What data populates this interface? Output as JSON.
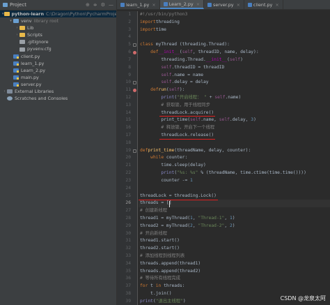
{
  "project_panel": {
    "title": "Project",
    "tree": [
      {
        "indent": 0,
        "arrow": "▾",
        "icon": "folder",
        "label": "python-learn",
        "sub": "C:\\Dragon\\Python\\PycharmProjects\\pytho",
        "bold": true
      },
      {
        "indent": 1,
        "arrow": "▾",
        "icon": "folder",
        "label": "venv",
        "sub": "library root"
      },
      {
        "indent": 2,
        "arrow": "›",
        "icon": "folder",
        "label": "Lib"
      },
      {
        "indent": 2,
        "arrow": "›",
        "icon": "folder",
        "label": "Scripts"
      },
      {
        "indent": 2,
        "arrow": "",
        "icon": "file",
        "label": ".gitignore"
      },
      {
        "indent": 2,
        "arrow": "",
        "icon": "file",
        "label": "pyvenv.cfg"
      },
      {
        "indent": 1,
        "arrow": "",
        "icon": "py",
        "label": "client.py"
      },
      {
        "indent": 1,
        "arrow": "",
        "icon": "py",
        "label": "learn_1.py"
      },
      {
        "indent": 1,
        "arrow": "",
        "icon": "py",
        "label": "Learn_2.py"
      },
      {
        "indent": 1,
        "arrow": "",
        "icon": "py",
        "label": "main.py"
      },
      {
        "indent": 1,
        "arrow": "",
        "icon": "py",
        "label": "server.py"
      },
      {
        "indent": 0,
        "arrow": "›",
        "icon": "lib",
        "label": "External Libraries"
      },
      {
        "indent": 0,
        "arrow": "",
        "icon": "scratch",
        "label": "Scratches and Consoles"
      }
    ]
  },
  "tabs": [
    {
      "label": "learn_1.py",
      "active": false
    },
    {
      "label": "Learn_2.py",
      "active": true
    },
    {
      "label": "server.py",
      "active": false
    },
    {
      "label": "client.py",
      "active": false
    }
  ],
  "editor": {
    "current_line": 26,
    "lines": [
      [
        [
          "cm",
          "#!/usr/bin/python3"
        ]
      ],
      [
        [
          "kw",
          "import"
        ],
        [
          "",
          "threading"
        ]
      ],
      [
        [
          "kw",
          "import"
        ],
        [
          "",
          "time"
        ]
      ],
      [],
      [
        [
          "kw",
          "class"
        ],
        [
          "",
          " myThread (threading.Thread):"
        ]
      ],
      [
        [
          "",
          "    "
        ],
        [
          "kw",
          "def"
        ],
        [
          "",
          ""
        ],
        [
          "ma",
          "__init__"
        ],
        [
          "",
          "("
        ],
        [
          "sf",
          "self"
        ],
        [
          "",
          ", threadID, name, delay):"
        ]
      ],
      [
        [
          "",
          "        threading.Thread."
        ],
        [
          "ma",
          "__init__"
        ],
        [
          "",
          "("
        ],
        [
          "sf",
          "self"
        ],
        [
          "",
          ")"
        ]
      ],
      [
        [
          "",
          "        "
        ],
        [
          "sf",
          "self"
        ],
        [
          "",
          ".threadID = threadID"
        ]
      ],
      [
        [
          "",
          "        "
        ],
        [
          "sf",
          "self"
        ],
        [
          "",
          ".name = name"
        ]
      ],
      [
        [
          "",
          "        "
        ],
        [
          "sf",
          "self"
        ],
        [
          "",
          ".delay = delay"
        ]
      ],
      [
        [
          "",
          "    "
        ],
        [
          "kw",
          "def"
        ],
        [
          "",
          ""
        ],
        [
          "fn",
          "run"
        ],
        [
          "",
          "("
        ],
        [
          "sf",
          "self"
        ],
        [
          "",
          "):"
        ]
      ],
      [
        [
          "",
          "        "
        ],
        [
          "bi",
          "print"
        ],
        [
          "",
          "("
        ],
        [
          "st",
          "\"开启线程： \""
        ],
        [
          "",
          ""
        ],
        [
          "",
          ""
        ],
        [
          "",
          ""
        ],
        [
          "",
          ""
        ],
        [
          "",
          ""
        ],
        [
          "",
          ""
        ],
        [
          "",
          " + "
        ],
        [
          "sf",
          "self"
        ],
        [
          "",
          ".name)"
        ]
      ],
      [
        [
          "",
          "        "
        ],
        [
          "cm",
          "# 获取锁，用于线程同步"
        ]
      ],
      [
        [
          "",
          "        threadLock.acquire()"
        ]
      ],
      [
        [
          "",
          "        print_time("
        ],
        [
          "sf",
          "self"
        ],
        [
          "",
          ".name, "
        ],
        [
          "sf",
          "self"
        ],
        [
          "",
          ".delay, "
        ],
        [
          "nm",
          "3"
        ],
        [
          "",
          ")"
        ]
      ],
      [
        [
          "",
          "        "
        ],
        [
          "cm",
          "# 释放锁，开启下一个线程"
        ]
      ],
      [
        [
          "",
          "        threadLock.release()"
        ]
      ],
      [],
      [
        [
          "kw",
          "def"
        ],
        [
          "",
          ""
        ],
        [
          "fn",
          "print_time"
        ],
        [
          "",
          "(threadName, delay, counter):"
        ]
      ],
      [
        [
          "",
          "    "
        ],
        [
          "kw",
          "while"
        ],
        [
          "",
          " counter:"
        ]
      ],
      [
        [
          "",
          "        time.sleep(delay)"
        ]
      ],
      [
        [
          "",
          "        "
        ],
        [
          "bi",
          "print"
        ],
        [
          "",
          "("
        ],
        [
          "st",
          "\"%s: %s\""
        ],
        [
          "",
          " % (threadName, time.ctime(time.time())))"
        ]
      ],
      [
        [
          "",
          "        counter -= "
        ],
        [
          "nm",
          "1"
        ]
      ],
      [],
      [
        [
          "",
          "threadLock = threading.Lock()"
        ]
      ],
      [
        [
          "",
          "threads = []"
        ]
      ],
      [
        [
          "cm",
          "# 创建新线程"
        ]
      ],
      [
        [
          "",
          "thread1 = myThread("
        ],
        [
          "nm",
          "1"
        ],
        [
          "",
          ", "
        ],
        [
          "st",
          "\"Thread-1\""
        ],
        [
          "",
          ", "
        ],
        [
          "nm",
          "1"
        ],
        [
          "",
          ")"
        ]
      ],
      [
        [
          "",
          "thread2 = myThread("
        ],
        [
          "nm",
          "2"
        ],
        [
          "",
          ", "
        ],
        [
          "st",
          "\"Thread-2\""
        ],
        [
          "",
          ", "
        ],
        [
          "nm",
          "2"
        ],
        [
          "",
          ")"
        ]
      ],
      [
        [
          "cm",
          "# 开启新线程"
        ]
      ],
      [
        [
          "",
          "thread1.start()"
        ]
      ],
      [
        [
          "",
          "thread2.start()"
        ]
      ],
      [
        [
          "cm",
          "# 添加线程到线程列表"
        ]
      ],
      [
        [
          "",
          "threads.append(thread1)"
        ]
      ],
      [
        [
          "",
          "threads.append(thread2)"
        ]
      ],
      [
        [
          "cm",
          "# 等待所有线程完成"
        ]
      ],
      [
        [
          "kw",
          "for"
        ],
        [
          "",
          " t "
        ],
        [
          "kw",
          "in"
        ],
        [
          "",
          " threads:"
        ]
      ],
      [
        [
          "",
          "    t.join()"
        ]
      ],
      [
        [
          "bi",
          "print"
        ],
        [
          "",
          "("
        ],
        [
          "st",
          "\"退出主线程\""
        ],
        [
          "",
          ")"
        ]
      ]
    ]
  },
  "watermark": "CSDN @龙泉太阿",
  "annotation_color": "#e02020"
}
